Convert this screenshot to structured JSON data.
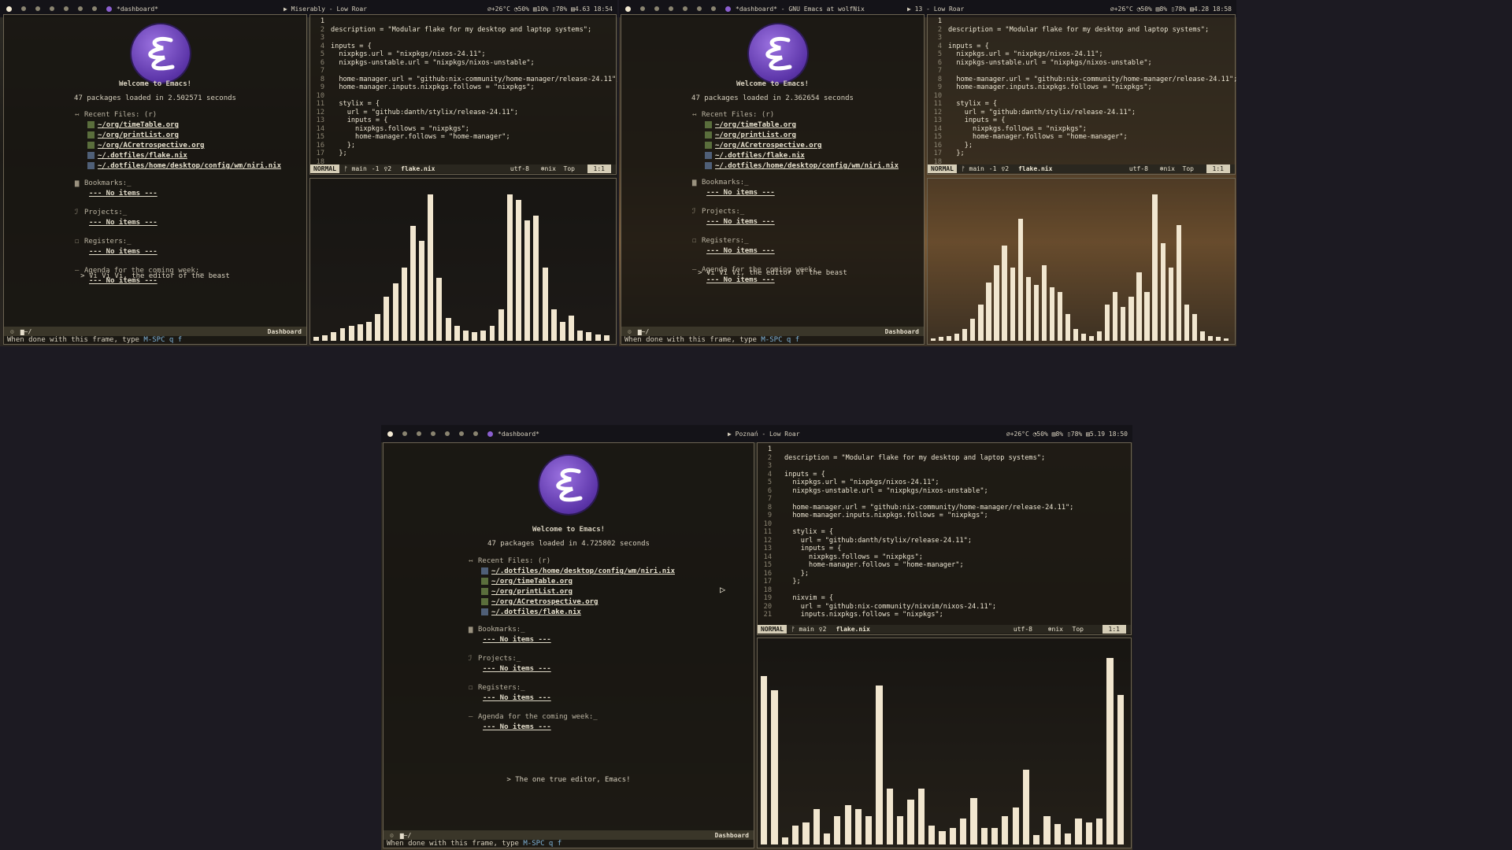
{
  "monitors": [
    {
      "bar": {
        "active_window_title": "*dashboard*",
        "music": "Miserably - Low Roar",
        "status": "⌀+26°C  ◔50%  ▥10%  ▯78%  ▤4.63  18:54"
      },
      "emacs": {
        "welcome": "Welcome to Emacs!",
        "loaded": "47 packages loaded in 2.502571 seconds",
        "recent_header": "Recent Files: (r)",
        "recent": [
          "~/org/timeTable.org",
          "~/org/printList.org",
          "~/org/ACretrospective.org",
          "~/.dotfiles/flake.nix",
          "~/.dotfiles/home/desktop/config/wm/niri.nix"
        ],
        "bookmarks": "Bookmarks:_",
        "projects": "Projects:_",
        "registers": "Registers:_",
        "agenda": "Agenda for the coming week:_",
        "no_items": "--- No items ---",
        "footer": "> Vi Vi Vi, the editor of the beast",
        "modeline_left": "~/",
        "modeline_right": "Dashboard",
        "echo_prefix": "When done with this frame, type ",
        "echo_key": "M-SPC q f"
      },
      "vim": {
        "branch": "main",
        "diag": "-1",
        "hints": "2",
        "file": "flake.nix",
        "enc": "utf-8",
        "ft": "nix",
        "scroll": "Top",
        "pos": "1:1",
        "mode": "NORMAL"
      },
      "visualizer": [
        4,
        5,
        8,
        12,
        14,
        16,
        18,
        26,
        42,
        55,
        70,
        110,
        96,
        140,
        60,
        22,
        14,
        10,
        8,
        10,
        14,
        30,
        140,
        135,
        115,
        120,
        70,
        30,
        18,
        24,
        10,
        8,
        6,
        5
      ]
    },
    {
      "bar": {
        "active_window_title": "*dashboard* - GNU Emacs at wolfNix",
        "music": "13 - Low Roar",
        "status": "⌀+26°C  ◔50%  ▥8%  ▯78%  ▤4.28  18:58"
      },
      "emacs": {
        "welcome": "Welcome to Emacs!",
        "loaded": "47 packages loaded in 2.362654 seconds",
        "recent_header": "Recent Files: (r)",
        "recent": [
          "~/org/timeTable.org",
          "~/org/printList.org",
          "~/org/ACretrospective.org",
          "~/.dotfiles/flake.nix",
          "~/.dotfiles/home/desktop/config/wm/niri.nix"
        ],
        "bookmarks": "Bookmarks:_",
        "projects": "Projects:_",
        "registers": "Registers:_",
        "agenda": "Agenda for the coming week:_",
        "no_items": "--- No items ---",
        "footer": "> Vi Vi Vi, the editor of the beast",
        "modeline_left": "~/",
        "modeline_right": "Dashboard",
        "echo_prefix": "When done with this frame, type ",
        "echo_key": "M-SPC q f"
      },
      "vim": {
        "branch": "main",
        "diag": "-1",
        "hints": "2",
        "file": "flake.nix",
        "enc": "utf-8",
        "ft": "nix",
        "scroll": "Top",
        "pos": "1:1",
        "mode": "NORMAL"
      },
      "visualizer": [
        2,
        3,
        4,
        6,
        10,
        18,
        30,
        48,
        62,
        78,
        60,
        100,
        52,
        46,
        62,
        44,
        40,
        22,
        10,
        6,
        4,
        8,
        30,
        40,
        28,
        36,
        56,
        40,
        120,
        80,
        60,
        95,
        30,
        22,
        8,
        4,
        3,
        2
      ]
    },
    {
      "bar": {
        "active_window_title": "*dashboard*",
        "music": "Poznań - Low Roar",
        "status": "⌀+26°C  ◔50%  ▥8%  ▯78%  ▤5.19  18:50"
      },
      "emacs": {
        "welcome": "Welcome to Emacs!",
        "loaded": "47 packages loaded in 4.725802 seconds",
        "recent_header": "Recent Files: (r)",
        "recent": [
          "~/.dotfiles/home/desktop/config/wm/niri.nix",
          "~/org/timeTable.org",
          "~/org/printList.org",
          "~/org/ACretrospective.org",
          "~/.dotfiles/flake.nix"
        ],
        "bookmarks": "Bookmarks:_",
        "projects": "Projects:_",
        "registers": "Registers:_",
        "agenda": "Agenda for the coming week:_",
        "no_items": "--- No items ---",
        "footer": "> The one true editor, Emacs!",
        "modeline_left": "~/",
        "modeline_right": "Dashboard",
        "echo_prefix": "When done with this frame, type ",
        "echo_key": "M-SPC q f"
      },
      "vim": {
        "branch": "main",
        "diag": "",
        "hints": "2",
        "file": "flake.nix",
        "enc": "utf-8",
        "ft": "nix",
        "scroll": "Top",
        "pos": "1:1",
        "mode": "NORMAL"
      },
      "visualizer": [
        180,
        165,
        8,
        20,
        24,
        38,
        12,
        30,
        42,
        38,
        30,
        170,
        60,
        30,
        48,
        60,
        20,
        14,
        18,
        28,
        50,
        18,
        18,
        30,
        40,
        80,
        10,
        30,
        22,
        12,
        28,
        24,
        28,
        200,
        160
      ]
    }
  ],
  "code_lines": [
    "",
    "description = \"Modular flake for my desktop and laptop systems\";",
    "",
    "inputs = {",
    "  nixpkgs.url = \"nixpkgs/nixos-24.11\";",
    "  nixpkgs-unstable.url = \"nixpkgs/nixos-unstable\";",
    "",
    "  home-manager.url = \"github:nix-community/home-manager/release-24.11\";",
    "  home-manager.inputs.nixpkgs.follows = \"nixpkgs\";",
    "",
    "  stylix = {",
    "    url = \"github:danth/stylix/release-24.11\";",
    "    inputs = {",
    "      nixpkgs.follows = \"nixpkgs\";",
    "      home-manager.follows = \"home-manager\";",
    "    };",
    "  };",
    "",
    "  nixvim = {",
    "    url = \"github:nix-community/nixvim/nixos-24.11\";",
    "    inputs.nixpkgs.follows = \"nixpkgs\";",
    "  };"
  ],
  "line_numbers": [
    "1",
    "2",
    "3",
    "4",
    "5",
    "6",
    "7",
    "8",
    "9",
    "10",
    "11",
    "12",
    "13",
    "14",
    "15",
    "16",
    "17",
    "18",
    "19",
    "20",
    "21"
  ]
}
